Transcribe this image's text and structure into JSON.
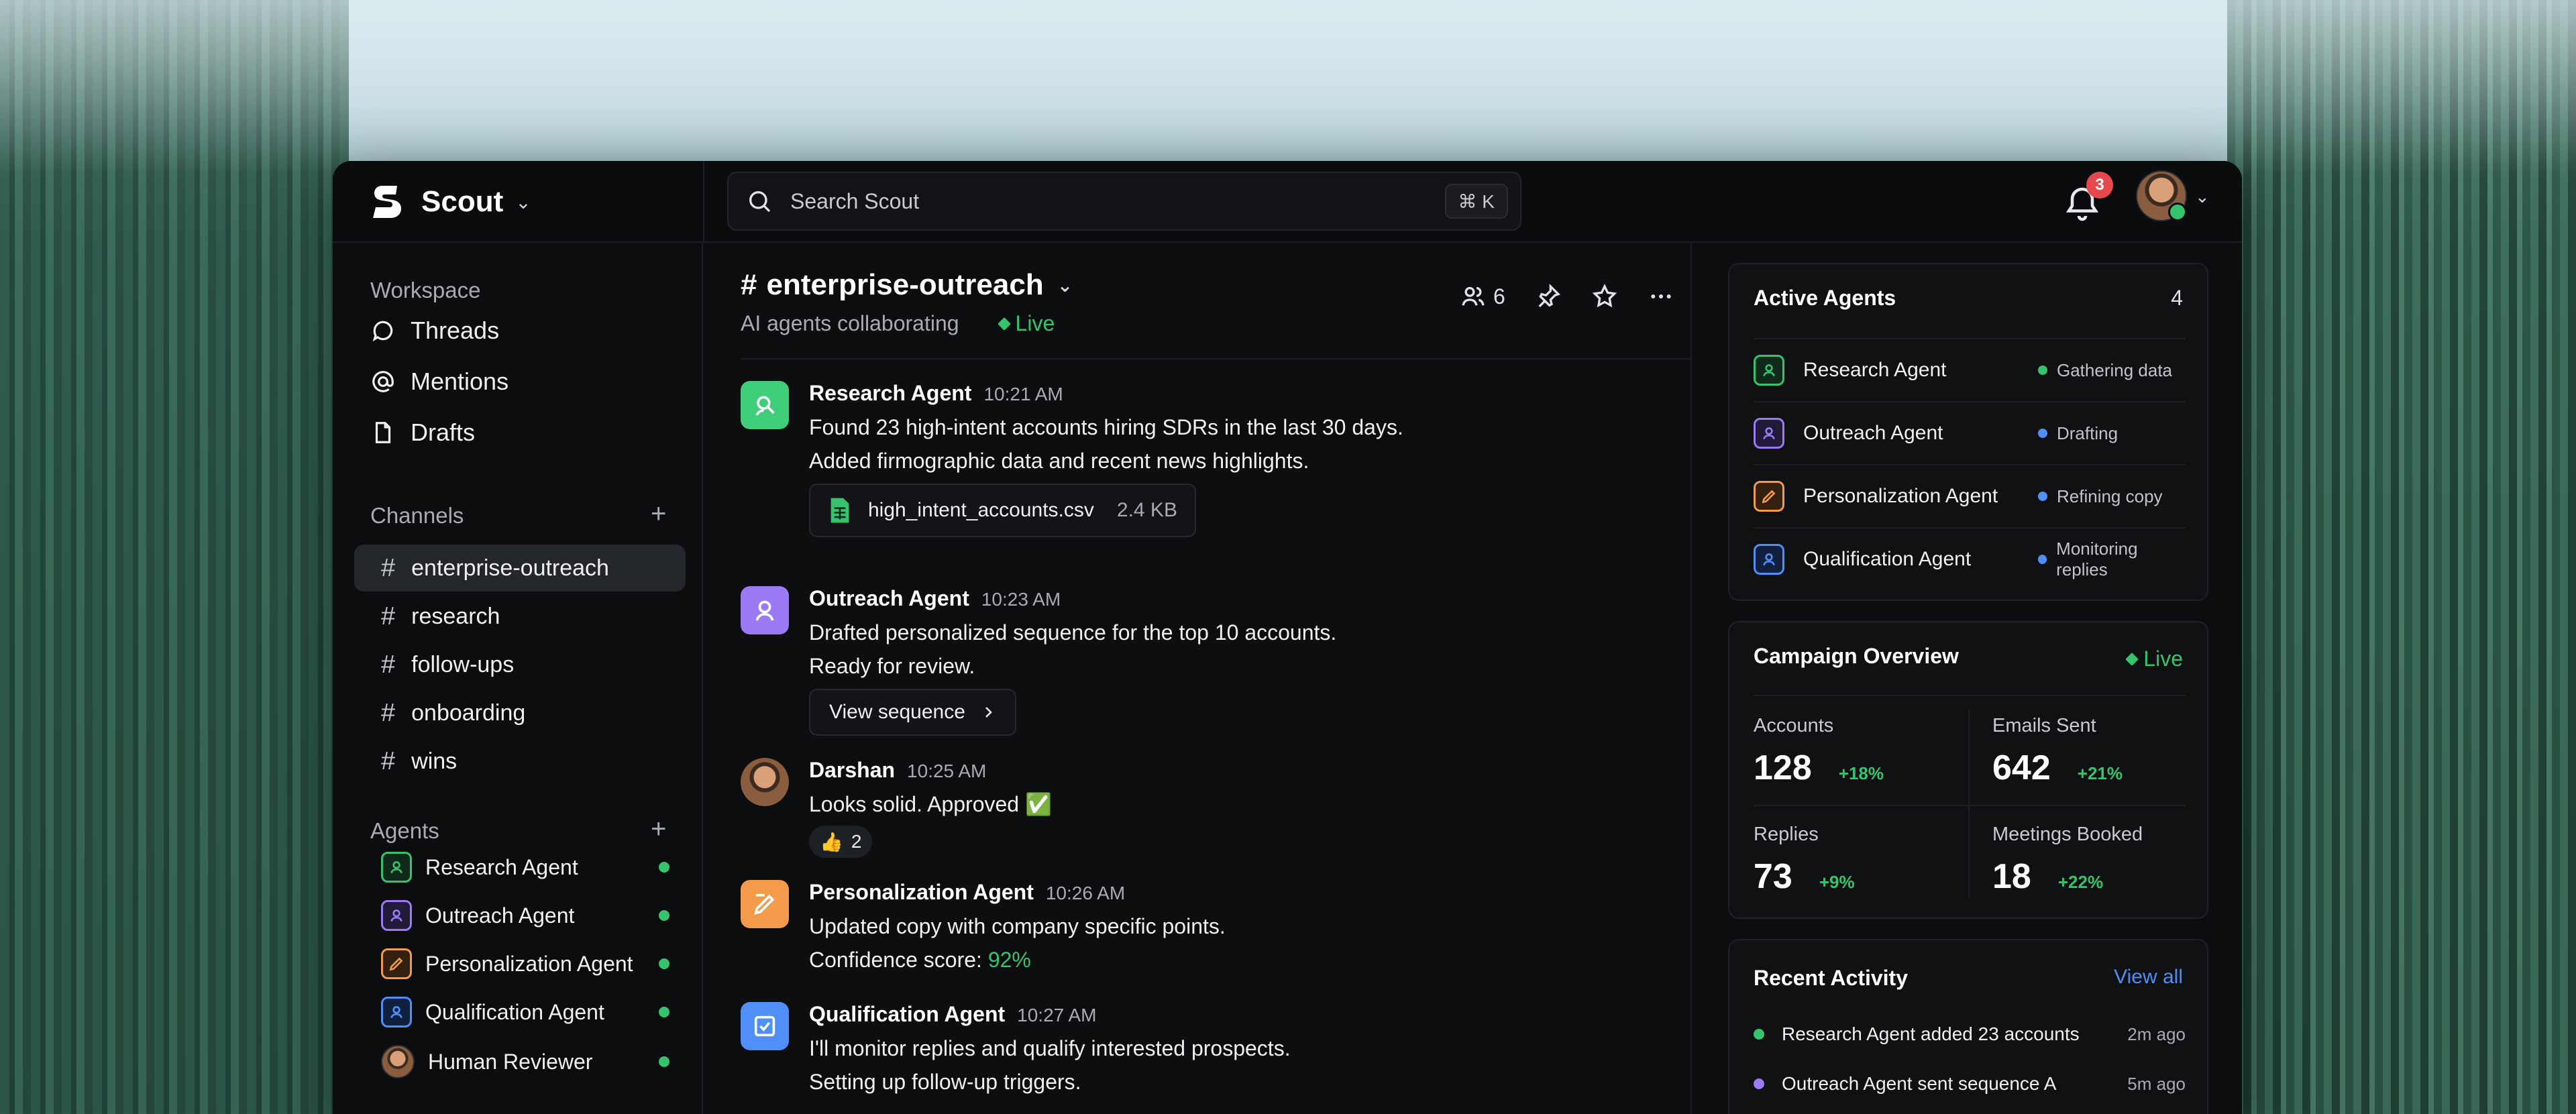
{
  "colors": {
    "accent_green": "#35c46d",
    "accent_blue": "#4f8ff7",
    "accent_purple": "#9b7af5",
    "accent_orange": "#f39b4a",
    "badge_red": "#e5484d"
  },
  "topbar": {
    "brand": "Scout",
    "search_placeholder": "Search Scout",
    "shortcut": "⌘ K",
    "notification_count": "3"
  },
  "sidebar": {
    "workspace_title": "Workspace",
    "workspace_items": [
      {
        "label": "Threads",
        "icon": "threads-icon"
      },
      {
        "label": "Mentions",
        "icon": "at-icon"
      },
      {
        "label": "Drafts",
        "icon": "file-icon"
      }
    ],
    "channels_title": "Channels",
    "channels": [
      "enterprise-outreach",
      "research",
      "follow-ups",
      "onboarding",
      "wins"
    ],
    "active_channel": "enterprise-outreach",
    "agents_title": "Agents",
    "agents": [
      "Research Agent",
      "Outreach Agent",
      "Personalization Agent",
      "Qualification Agent",
      "Human Reviewer"
    ]
  },
  "channel": {
    "name": "enterprise-outreach",
    "hash": "#",
    "subtitle": "AI agents collaborating",
    "status": "Live",
    "member_count": "6"
  },
  "messages": [
    {
      "author": "Research Agent",
      "time": "10:21 AM",
      "lines": [
        "Found 23 high-intent accounts hiring SDRs in the last 30 days.",
        "Added firmographic data and recent news highlights."
      ],
      "file": {
        "name": "high_intent_accounts.csv",
        "size": "2.4 KB"
      }
    },
    {
      "author": "Outreach Agent",
      "time": "10:23 AM",
      "lines": [
        "Drafted personalized sequence for the top 10 accounts.",
        "Ready for review."
      ],
      "button": "View sequence"
    },
    {
      "author": "Darshan",
      "time": "10:25 AM",
      "lines": [
        "Looks solid. Approved ✅"
      ],
      "reaction": {
        "emoji": "👍",
        "count": "2"
      }
    },
    {
      "author": "Personalization Agent",
      "time": "10:26 AM",
      "lines": [
        "Updated copy with company specific points."
      ],
      "confidence_label": "Confidence score: ",
      "confidence_value": "92%"
    },
    {
      "author": "Qualification Agent",
      "time": "10:27 AM",
      "lines": [
        "I'll monitor replies and qualify interested prospects.",
        "Setting up follow-up triggers."
      ]
    }
  ],
  "active_agents": {
    "title": "Active Agents",
    "count": "4",
    "rows": [
      {
        "name": "Research Agent",
        "status": "Gathering data",
        "status_color": "#35c46d"
      },
      {
        "name": "Outreach Agent",
        "status": "Drafting",
        "status_color": "#4f8ff7"
      },
      {
        "name": "Personalization Agent",
        "status": "Refining copy",
        "status_color": "#4f8ff7"
      },
      {
        "name": "Qualification Agent",
        "status": "Monitoring replies",
        "status_color": "#4f8ff7"
      }
    ]
  },
  "campaign": {
    "title": "Campaign Overview",
    "status": "Live",
    "metrics": [
      {
        "label": "Accounts",
        "value": "128",
        "delta": "+18%"
      },
      {
        "label": "Emails Sent",
        "value": "642",
        "delta": "+21%"
      },
      {
        "label": "Replies",
        "value": "73",
        "delta": "+9%"
      },
      {
        "label": "Meetings Booked",
        "value": "18",
        "delta": "+22%"
      }
    ]
  },
  "recent_activity": {
    "title": "Recent Activity",
    "view_all": "View all",
    "rows": [
      {
        "text": "Research Agent added 23 accounts",
        "ago": "2m ago",
        "color": "#35c46d"
      },
      {
        "text": "Outreach Agent sent sequence A",
        "ago": "5m ago",
        "color": "#9b7af5"
      }
    ]
  }
}
